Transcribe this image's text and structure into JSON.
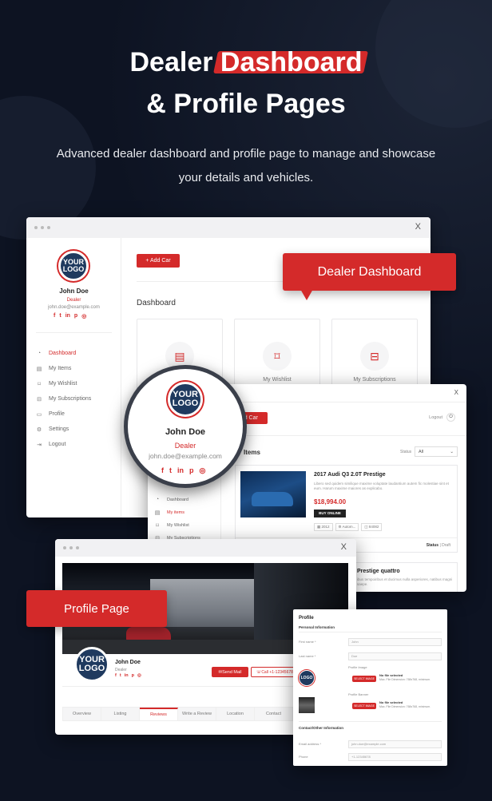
{
  "hero": {
    "title_part1": "Dealer ",
    "title_highlight": "Dashboard",
    "title_line2": "& Profile Pages",
    "subtitle": "Advanced dealer dashboard and profile page to manage and showcase your details and vehicles."
  },
  "colors": {
    "accent": "#d42a2a",
    "background": "#0d1322"
  },
  "callouts": {
    "dashboard": "Dealer Dashboard",
    "profile": "Profile Page"
  },
  "dashboard_window": {
    "close": "X",
    "logo_line1": "YOUR",
    "logo_line2": "LOGO",
    "user_name": "John Doe",
    "user_role": "Dealer",
    "user_email": "john.doe@example.com",
    "social_icons": [
      "f",
      "t",
      "in",
      "p",
      "ig"
    ],
    "add_car_label": "+ Add Car",
    "section_title": "Dashboard",
    "nav": [
      {
        "label": "Dashboard",
        "icon": "gauge-icon",
        "active": true
      },
      {
        "label": "My Items",
        "icon": "list-icon",
        "active": false
      },
      {
        "label": "My Wishlist",
        "icon": "bookmark-icon",
        "active": false
      },
      {
        "label": "My Subscriptions",
        "icon": "car-icon",
        "active": false
      },
      {
        "label": "Profile",
        "icon": "id-card-icon",
        "active": false
      },
      {
        "label": "Settings",
        "icon": "gear-icon",
        "active": false
      },
      {
        "label": "Logout",
        "icon": "logout-icon",
        "active": false
      }
    ],
    "cards": [
      {
        "label": "My Items",
        "icon": "list-icon"
      },
      {
        "label": "My Wishlist",
        "icon": "bookmark-icon"
      },
      {
        "label": "My Subscriptions",
        "icon": "car-icon"
      }
    ]
  },
  "zoom_circle": {
    "logo_line1": "YOUR",
    "logo_line2": "LOGO",
    "name": "John Doe",
    "role": "Dealer",
    "email": "john.doe@example.com"
  },
  "items_window": {
    "close": "X",
    "add_car_label": "Add Car",
    "logout_label": "Logout",
    "title": "Items",
    "status_label": "Status",
    "status_value": "All",
    "nav": [
      {
        "label": "Dashboard",
        "active": false
      },
      {
        "label": "My items",
        "active": true
      },
      {
        "label": "My Wishlist",
        "active": false
      },
      {
        "label": "My Subscriptions",
        "active": false
      }
    ],
    "listing": {
      "title": "2017 Audi Q3 2.0T Prestige",
      "description": "Libero sed quidem similique maxime voluptate laudantium autem fic molestiae sint et eum. Harum maxime maiores as explicabo.",
      "price": "$18,994.00",
      "buy_label": "BUY ONLINE",
      "specs": [
        "2012",
        "Autom...",
        "84082"
      ],
      "footer_left": "Edit",
      "footer_status_label": "Status",
      "footer_status_value": "Draft"
    },
    "listing2": {
      "title": "Prestige quattro",
      "description": "ibus tempoiribus et ducimus nulla asperiores, natibus magni saepe."
    }
  },
  "profile_window": {
    "close": "X",
    "logo_line1": "YOUR",
    "logo_line2": "LOGO",
    "name": "John Doe",
    "role": "Dealer",
    "send_mail_label": "Send Mail",
    "phone_label": "Call +1-12345678",
    "tabs": [
      {
        "label": "Overview",
        "active": false
      },
      {
        "label": "Listing",
        "active": false
      },
      {
        "label": "Reviews",
        "active": true
      },
      {
        "label": "Write a Review",
        "active": false
      },
      {
        "label": "Location",
        "active": false
      },
      {
        "label": "Contact",
        "active": false
      }
    ]
  },
  "profile_form": {
    "title": "Profile",
    "section1": "Personal Information",
    "first_name_label": "First name *",
    "first_name_value": "John",
    "last_name_label": "Last name *",
    "last_name_value": "Doe",
    "profile_image_label": "Profile Image",
    "profile_banner_label": "Profile Banner",
    "select_label": "SELECT IMAGE",
    "no_file": "No file selected",
    "hint": "Max. File Dimension: 768x768, minimum.",
    "section2": "Contact/Other Information",
    "email_label": "Email address *",
    "email_value": "john.doe@example.com",
    "phone_label": "Phone",
    "phone_value": "+1-12345678"
  }
}
